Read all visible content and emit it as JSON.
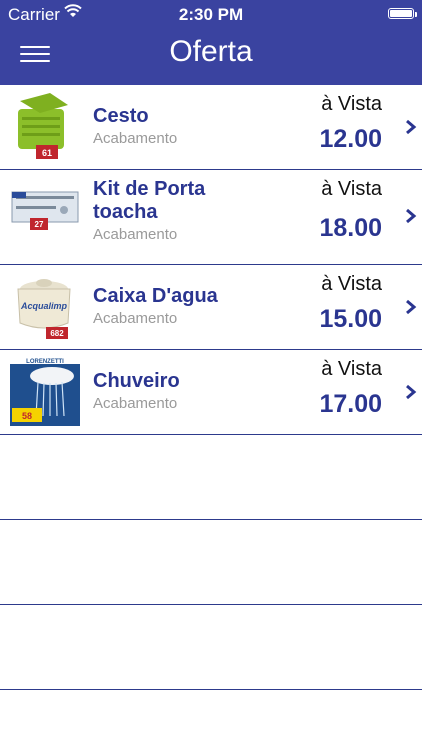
{
  "status_bar": {
    "carrier": "Carrier",
    "time": "2:30 PM"
  },
  "header": {
    "title": "Oferta"
  },
  "items": [
    {
      "name": "Cesto",
      "subtitle": "Acabamento",
      "payment_label": "à Vista",
      "price": "12.00",
      "thumb_tag": "61"
    },
    {
      "name": "Kit de Porta toacha",
      "subtitle": "Acabamento",
      "payment_label": "à Vista",
      "price": "18.00",
      "thumb_tag": "27"
    },
    {
      "name": "Caixa D'agua",
      "subtitle": "Acabamento",
      "payment_label": "à Vista",
      "price": "15.00",
      "thumb_tag": "682"
    },
    {
      "name": "Chuveiro",
      "subtitle": "Acabamento",
      "payment_label": "à Vista",
      "price": "17.00",
      "thumb_tag": "58"
    }
  ],
  "thumb_texts": {
    "caixa_brand": "Acqualimp",
    "chuveiro_brand": "LORENZETTI"
  },
  "colors": {
    "nav_bar": "#3a43a0",
    "title_text": "#2a3590",
    "separator": "#2d3a8c"
  }
}
